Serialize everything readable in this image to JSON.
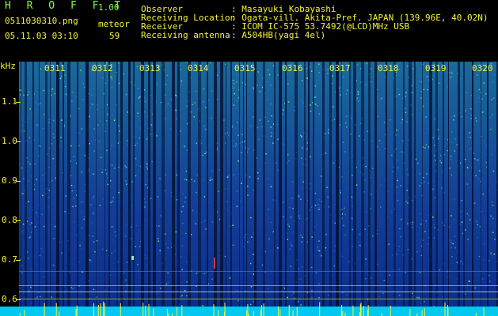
{
  "header": {
    "app_title": "H R O F F T",
    "app_version": "1.00",
    "file_name": "0511030310.png",
    "detection_label": "meteor",
    "date_time": "05.11.03 03:10",
    "detection_count": "59"
  },
  "station_info": [
    {
      "key": "Observer",
      "value": ": Masayuki Kobayashi"
    },
    {
      "key": "Receiving Location",
      "value": ": Ogata-vill. Akita-Pref. JAPAN (139.96E, 40.02N)"
    },
    {
      "key": "Receiver",
      "value": ": ICOM IC-575 53.7492(@LCD)MHz USB"
    },
    {
      "key": "Receiving antenna",
      "value": ": A504HB(yagi 4el)"
    }
  ],
  "axis": {
    "unit": "kHz",
    "y_labels": [
      "1.1",
      "1.0",
      "0.9",
      "0.8",
      "0.7",
      "0.6"
    ],
    "x_labels": [
      "0311",
      "0312",
      "0313",
      "0314",
      "0315",
      "0316",
      "0317",
      "0318",
      "0319",
      "0320"
    ]
  },
  "colors": {
    "header_green": "#7CFF3A",
    "header_yellow": "#F4F23A",
    "spectrum_blue": "#1A3FA8",
    "spectrum_cyan": "#00C8E8"
  }
}
